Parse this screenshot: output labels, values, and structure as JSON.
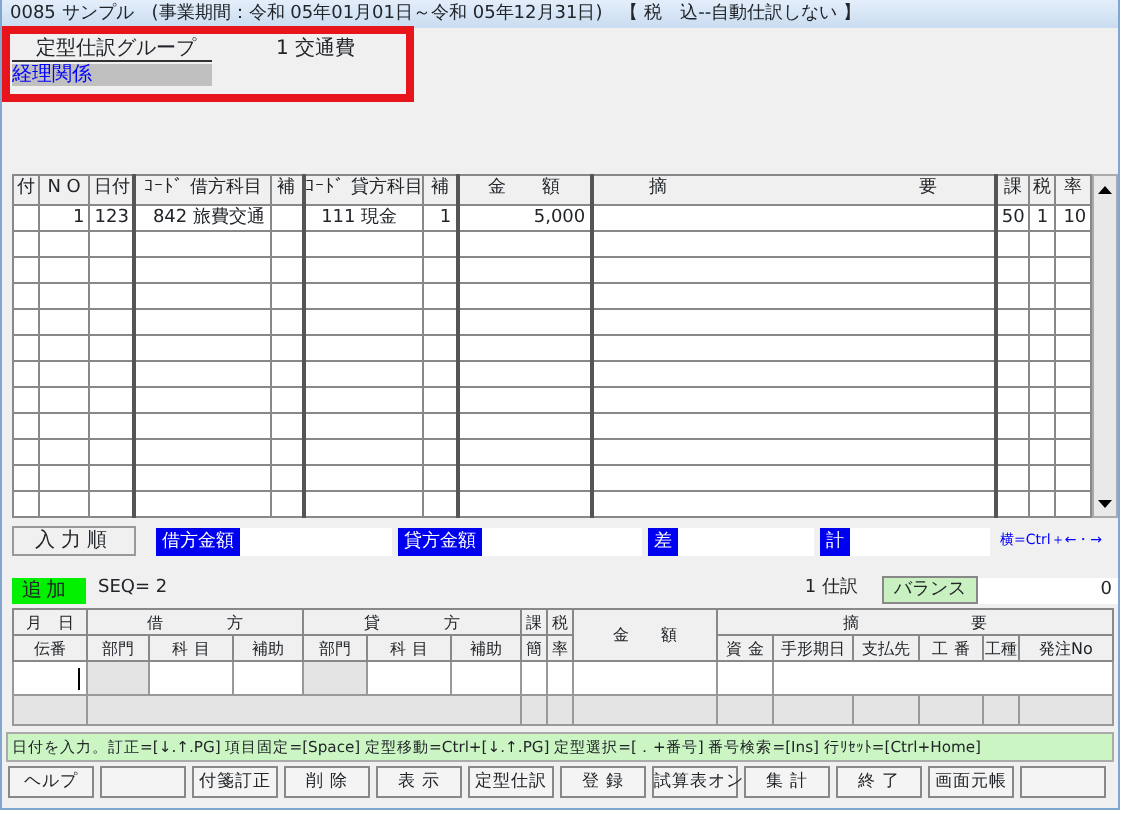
{
  "window": {
    "title": "0085 サンプル　(事業期間：令和 05年01月01日～令和 05年12月31日)　【 税　込--自動仕訳しない 】"
  },
  "annotation": {
    "kind": "red_box"
  },
  "group": {
    "label": "定型仕訳グループ",
    "value": "1 交通費",
    "category": "経理関係"
  },
  "journal": {
    "columns": [
      "付",
      "N O",
      "日付",
      "ｺｰﾄﾞ 借方科目",
      "補",
      "ｺｰﾄﾞ 貸方科目",
      "補",
      "金　　額",
      "摘　　　　　　　　　　　　　　要",
      "課",
      "税",
      "率"
    ],
    "rows": [
      {
        "cells": [
          "",
          "1",
          "123",
          "842 旅費交通",
          "",
          "111 現金",
          "1",
          "5,000",
          "",
          "50",
          "1",
          "10"
        ]
      }
    ]
  },
  "totals": {
    "order_button": "入力順",
    "labels": [
      "借方金額",
      "貸方金額",
      "差",
      "計"
    ],
    "hint": "横=Ctrl＋←・→"
  },
  "entry": {
    "mode": "追加",
    "seq": "SEQ= 2",
    "count": "1 仕訳",
    "balance_label": "バランス",
    "balance": "0",
    "header_top": [
      "月　日",
      "借　　　　方",
      "貸　　　　方",
      "課",
      "税",
      "金　　額",
      "摘　　　　　　　要"
    ],
    "header_bottom": [
      "伝番",
      "部門",
      "科 目",
      "補助",
      "部門",
      "科 目",
      "補助",
      "簡",
      "率",
      "資 金",
      "手形期日",
      "支払先",
      "工 番",
      "工種",
      "発注No"
    ]
  },
  "status": "日付を入力。訂正=[↓.↑.PG] 項目固定=[Space] 定型移動=Ctrl+[↓.↑.PG] 定型選択=[．+番号] 番号検索=[Ins] 行ﾘｾｯﾄ=[Ctrl+Home]",
  "buttons": [
    {
      "kind": "label",
      "label": "ヘルプ"
    },
    {
      "kind": "blank"
    },
    {
      "kind": "label",
      "label": "付箋訂正"
    },
    {
      "kind": "label",
      "label": "削 除"
    },
    {
      "kind": "label",
      "label": "表 示"
    },
    {
      "kind": "label",
      "label": "定型仕訳"
    },
    {
      "kind": "label",
      "label": "登 録"
    },
    {
      "kind": "label",
      "label": "試算表オン"
    },
    {
      "kind": "label",
      "label": "集 計"
    },
    {
      "kind": "label",
      "label": "終 了"
    },
    {
      "kind": "label",
      "label": "画面元帳"
    },
    {
      "kind": "blank"
    }
  ]
}
